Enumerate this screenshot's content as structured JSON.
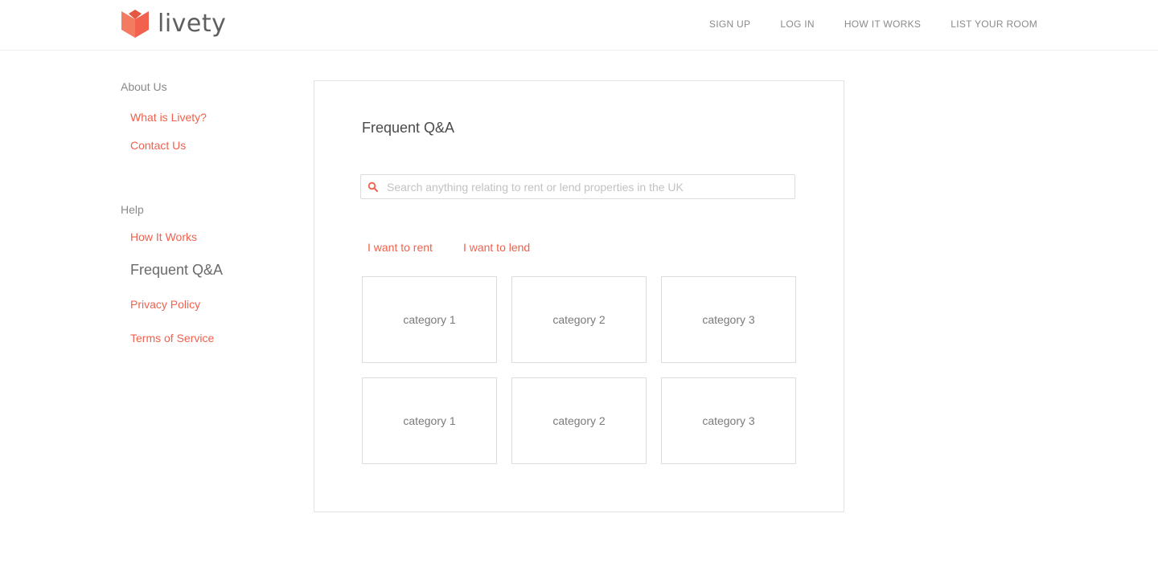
{
  "brand": {
    "name": "livety",
    "accent_color": "#f1614d",
    "logo_colors": [
      "#f27b62",
      "#f1614d",
      "#e45842"
    ]
  },
  "nav": {
    "items": [
      {
        "label": "SIGN UP"
      },
      {
        "label": "LOG IN"
      },
      {
        "label": "HOW IT WORKS"
      },
      {
        "label": "LIST YOUR ROOM"
      }
    ]
  },
  "sidebar": {
    "about_heading": "About Us",
    "about_links": [
      {
        "label": "What is Livety?"
      },
      {
        "label": "Contact Us"
      }
    ],
    "help_heading": "Help",
    "help_links": [
      {
        "label": "How It Works"
      },
      {
        "label": "Frequent Q&A",
        "active": true
      },
      {
        "label": "Privacy Policy"
      },
      {
        "label": "Terms of Service"
      }
    ]
  },
  "main": {
    "title": "Frequent Q&A",
    "search": {
      "placeholder": "Search anything relating to rent or lend properties in the UK",
      "value": "",
      "icon": "search-icon"
    },
    "tabs": [
      {
        "label": "I want to rent"
      },
      {
        "label": "I want to lend"
      }
    ],
    "categories": [
      {
        "label": "category 1"
      },
      {
        "label": "category 2"
      },
      {
        "label": "category 3"
      },
      {
        "label": "category 1"
      },
      {
        "label": "category 2"
      },
      {
        "label": "category 3"
      }
    ]
  }
}
